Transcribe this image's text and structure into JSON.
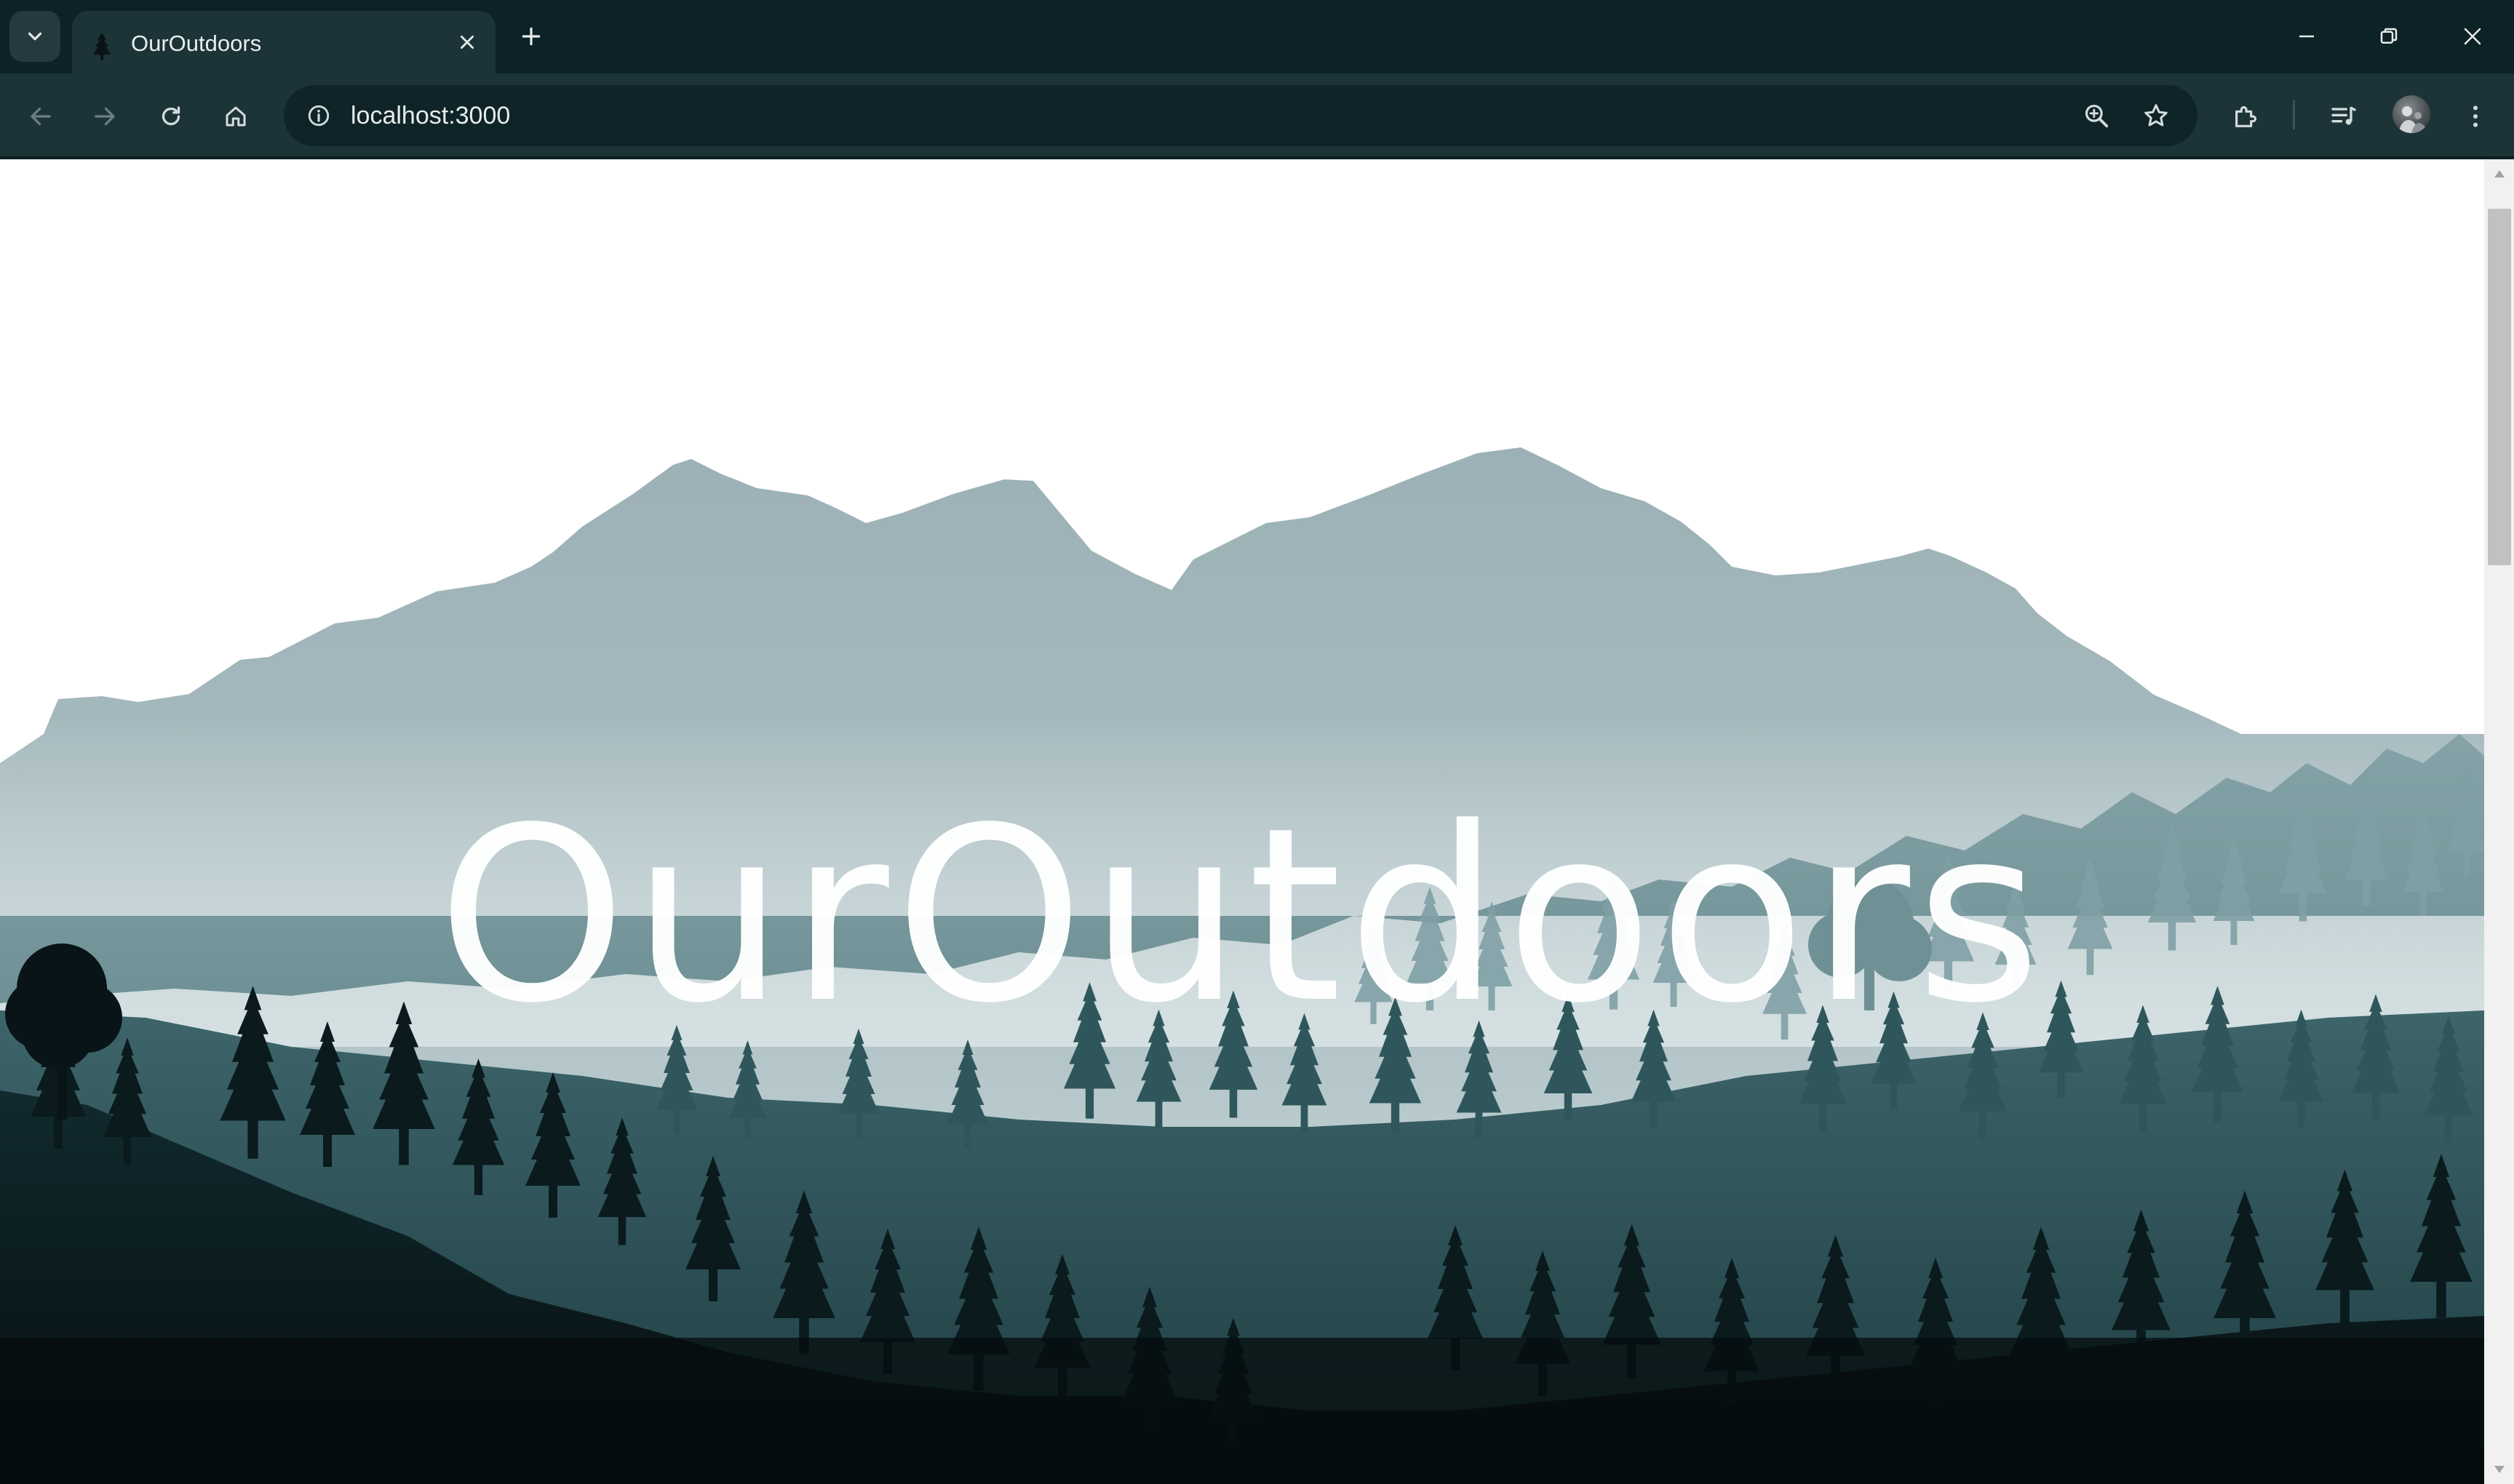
{
  "browser": {
    "tab": {
      "title": "OurOutdoors"
    },
    "address_bar": {
      "url": "localhost:3000"
    },
    "icons": {
      "tab_search": "chevron-down-icon",
      "favicon": "tree-icon",
      "tab_close": "close-icon",
      "new_tab": "plus-icon",
      "minimize": "minimize-icon",
      "restore": "restore-icon",
      "close_window": "close-icon",
      "back": "arrow-left-icon",
      "forward": "arrow-right-icon",
      "reload": "reload-icon",
      "home": "home-icon",
      "site_info": "info-icon",
      "zoom": "zoom-in-icon",
      "bookmark": "star-icon",
      "extensions": "puzzle-icon",
      "media": "media-queue-icon",
      "profile": "avatar",
      "menu": "kebab-menu-icon"
    },
    "colors": {
      "frame": "#0d2226",
      "toolbar": "#1c3337",
      "omnibox": "#0f2428",
      "icon": "#c9d4d5"
    }
  },
  "hero": {
    "title": "OurOutdoors",
    "colors": {
      "sky": "#ffffff",
      "mountains": "#9eb3b8",
      "mist": "#c9d7d9",
      "far_trees": "#6f9196",
      "mid_trees": "#2e5358",
      "near_trees": "#0b1c20",
      "title": "#ffffff"
    }
  },
  "scrollbar": {
    "position_fraction": 0.0,
    "visible_fraction": 0.27
  }
}
